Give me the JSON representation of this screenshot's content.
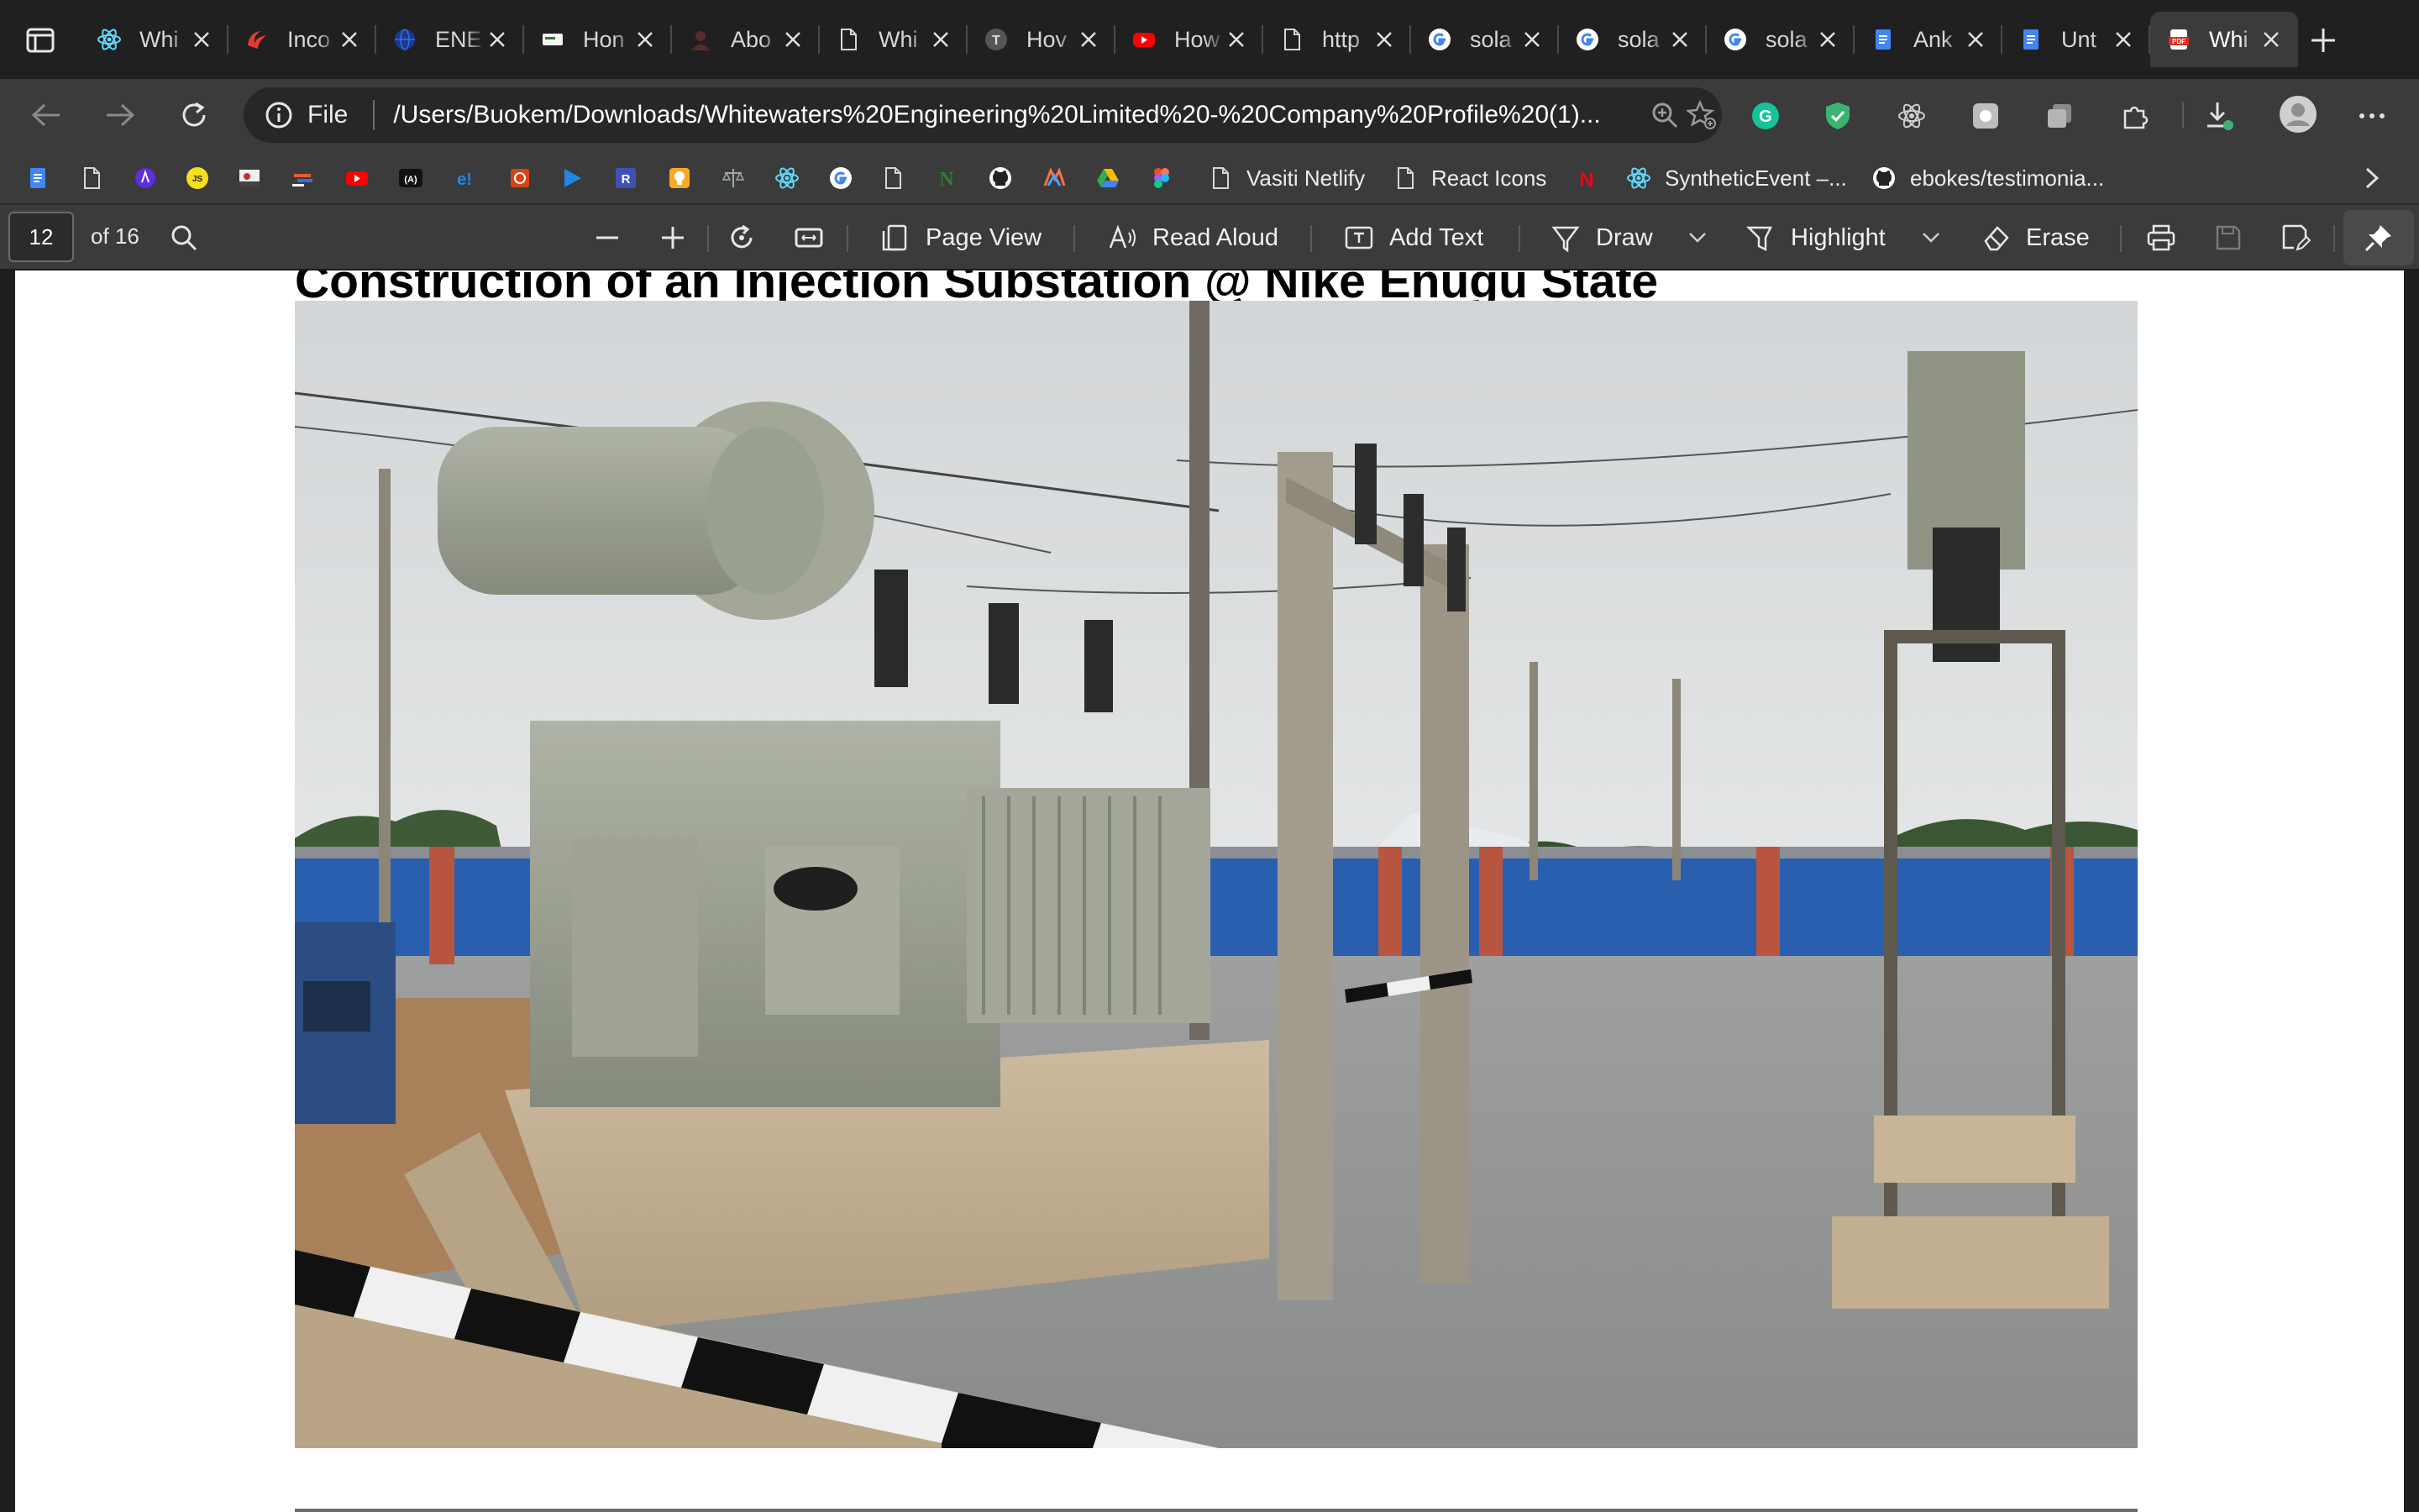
{
  "tabs": [
    {
      "label": "Whi",
      "icon": "react-icon"
    },
    {
      "label": "Inco",
      "icon": "brand-swoosh-icon"
    },
    {
      "label": "ENE",
      "icon": "globe-blue-icon"
    },
    {
      "label": "Hon",
      "icon": "site-card-icon"
    },
    {
      "label": "Abo",
      "icon": "person-icon"
    },
    {
      "label": "Whi",
      "icon": "document-icon"
    },
    {
      "label": "Hov",
      "icon": "t-logo-icon"
    },
    {
      "label": "How",
      "icon": "youtube-icon"
    },
    {
      "label": "http",
      "icon": "document-icon"
    },
    {
      "label": "sola",
      "icon": "google-icon"
    },
    {
      "label": "sola",
      "icon": "google-icon"
    },
    {
      "label": "sola",
      "icon": "google-icon"
    },
    {
      "label": "Ank",
      "icon": "google-docs-icon"
    },
    {
      "label": "Unt",
      "icon": "google-docs-icon"
    },
    {
      "label": "Whi",
      "icon": "pdf-icon",
      "active": true
    }
  ],
  "address": {
    "scheme_label": "File",
    "url": "/Users/Buokem/Downloads/Whitewaters%20Engineering%20Limited%20-%20Company%20Profile%20(1)..."
  },
  "bookmarks": [
    {
      "icon": "google-docs-icon",
      "label": ""
    },
    {
      "icon": "document-icon",
      "label": ""
    },
    {
      "icon": "purple-app-icon",
      "label": ""
    },
    {
      "icon": "js-icon",
      "label": "",
      "glyph": "JS"
    },
    {
      "icon": "image-thumb-icon",
      "label": ""
    },
    {
      "icon": "bar-logo-icon",
      "label": ""
    },
    {
      "icon": "youtube-icon",
      "label": ""
    },
    {
      "icon": "angular-like-icon",
      "label": "",
      "glyph": "(A)"
    },
    {
      "icon": "e-logo-icon",
      "label": "",
      "glyph": "e!"
    },
    {
      "icon": "red-square-icon",
      "label": ""
    },
    {
      "icon": "play-blue-icon",
      "label": ""
    },
    {
      "icon": "r-logo-icon",
      "label": "",
      "glyph": "R"
    },
    {
      "icon": "yellow-bulb-icon",
      "label": ""
    },
    {
      "icon": "scales-icon",
      "label": ""
    },
    {
      "icon": "react-icon",
      "label": ""
    },
    {
      "icon": "google-icon",
      "label": ""
    },
    {
      "icon": "document-icon",
      "label": ""
    },
    {
      "icon": "n-green-icon",
      "label": "",
      "glyph": "N"
    },
    {
      "icon": "github-icon",
      "label": ""
    },
    {
      "icon": "colorful-icon",
      "label": ""
    },
    {
      "icon": "google-drive-icon",
      "label": ""
    },
    {
      "icon": "figma-icon",
      "label": ""
    },
    {
      "icon": "document-icon",
      "label": "Vasiti Netlify"
    },
    {
      "icon": "document-icon",
      "label": "React Icons"
    },
    {
      "icon": "netflix-icon",
      "label": "",
      "glyph": "N"
    },
    {
      "icon": "react-icon",
      "label": "SyntheticEvent –..."
    },
    {
      "icon": "github-icon",
      "label": "ebokes/testimonia..."
    }
  ],
  "pdf_toolbar": {
    "page_number": "12",
    "page_count": "of 16",
    "page_view": "Page View",
    "read_aloud": "Read Aloud",
    "add_text": "Add Text",
    "draw": "Draw",
    "highlight": "Highlight",
    "erase": "Erase"
  },
  "document": {
    "title": "Construction of an Injection Substation @ Nike Enugu State"
  },
  "colors": {
    "tabstrip": "#202020",
    "toolbar": "#3b3b3b",
    "page": "#ffffff",
    "fence_blue": "#2a5fb0"
  }
}
